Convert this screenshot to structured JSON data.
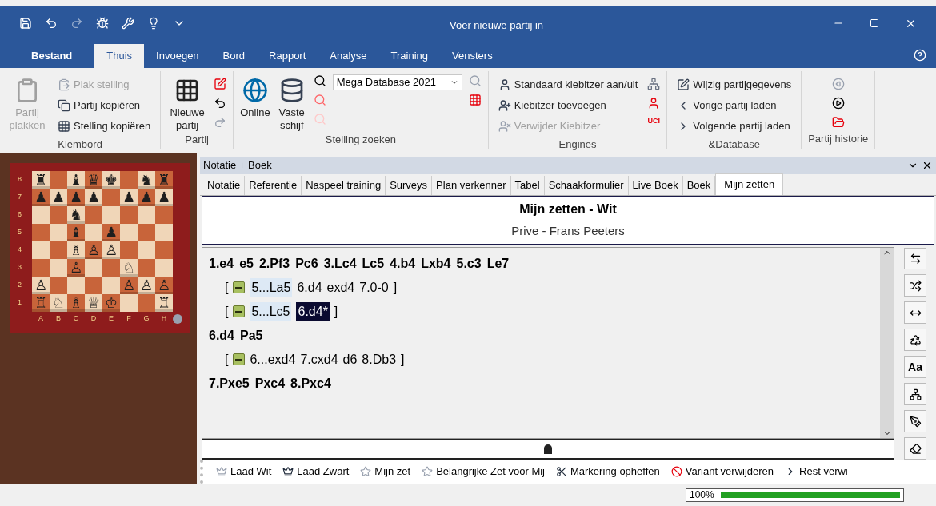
{
  "window": {
    "title": "Voer nieuwe partij in"
  },
  "ribbon_tabs": [
    {
      "label": "Bestand",
      "selected": false
    },
    {
      "label": "Thuis",
      "selected": true
    },
    {
      "label": "Invoegen",
      "selected": false
    },
    {
      "label": "Bord",
      "selected": false
    },
    {
      "label": "Rapport",
      "selected": false
    },
    {
      "label": "Analyse",
      "selected": false
    },
    {
      "label": "Training",
      "selected": false
    },
    {
      "label": "Vensters",
      "selected": false
    }
  ],
  "ribbon": {
    "klembord": {
      "label": "Klembord",
      "paste": {
        "label": "Partij plakken",
        "disabled": true
      },
      "items": [
        {
          "label": "Plak stelling",
          "disabled": true
        },
        {
          "label": "Partij kopiëren",
          "disabled": false
        },
        {
          "label": "Stelling kopiëren",
          "disabled": false
        }
      ]
    },
    "partij": {
      "label": "Partij",
      "new_game": "Nieuwe partij"
    },
    "stelling_zoeken": {
      "label": "Stelling zoeken",
      "online": "Online",
      "disk": "Vaste schijf",
      "database": "Mega Database 2021"
    },
    "engines": {
      "label": "Engines",
      "uci": "UCI",
      "items": [
        {
          "label": "Standaard kiebitzer aan/uit",
          "disabled": false
        },
        {
          "label": "Kiebitzer toevoegen",
          "disabled": false
        },
        {
          "label": "Verwijder Kiebitzer",
          "disabled": true
        }
      ]
    },
    "database": {
      "label": "&Database",
      "items": [
        {
          "label": "Wijzig partijgegevens",
          "disabled": false
        },
        {
          "label": "Vorige partij laden",
          "disabled": false
        },
        {
          "label": "Volgende partij laden",
          "disabled": false
        }
      ]
    },
    "historie": {
      "label": "Partij historie"
    }
  },
  "board": {
    "rank_labels": [
      "8",
      "7",
      "6",
      "5",
      "4",
      "3",
      "2",
      "1"
    ],
    "file_labels": [
      "A",
      "B",
      "C",
      "D",
      "E",
      "F",
      "G",
      "H"
    ],
    "position": [
      [
        {
          "empty": false,
          "piece": "♜"
        },
        {
          "empty": true
        },
        {
          "empty": false,
          "piece": "♝"
        },
        {
          "empty": false,
          "piece": "♛"
        },
        {
          "empty": false,
          "piece": "♚"
        },
        {
          "empty": true
        },
        {
          "empty": false,
          "piece": "♞"
        },
        {
          "empty": false,
          "piece": "♜"
        }
      ],
      [
        {
          "empty": false,
          "piece": "♟"
        },
        {
          "empty": false,
          "piece": "♟"
        },
        {
          "empty": false,
          "piece": "♟"
        },
        {
          "empty": false,
          "piece": "♟"
        },
        {
          "empty": true
        },
        {
          "empty": false,
          "piece": "♟"
        },
        {
          "empty": false,
          "piece": "♟"
        },
        {
          "empty": false,
          "piece": "♟"
        }
      ],
      [
        {
          "empty": true
        },
        {
          "empty": true
        },
        {
          "empty": false,
          "piece": "♞"
        },
        {
          "empty": true
        },
        {
          "empty": true
        },
        {
          "empty": true
        },
        {
          "empty": true
        },
        {
          "empty": true
        }
      ],
      [
        {
          "empty": true
        },
        {
          "empty": true
        },
        {
          "empty": false,
          "piece": "♝"
        },
        {
          "empty": true
        },
        {
          "empty": false,
          "piece": "♟"
        },
        {
          "empty": true
        },
        {
          "empty": true
        },
        {
          "empty": true
        }
      ],
      [
        {
          "empty": true
        },
        {
          "empty": true
        },
        {
          "empty": false,
          "piece": "♗"
        },
        {
          "empty": false,
          "piece": "♙"
        },
        {
          "empty": false,
          "piece": "♙"
        },
        {
          "empty": true
        },
        {
          "empty": true
        },
        {
          "empty": true
        }
      ],
      [
        {
          "empty": true
        },
        {
          "empty": true
        },
        {
          "empty": false,
          "piece": "♙"
        },
        {
          "empty": true
        },
        {
          "empty": true
        },
        {
          "empty": false,
          "piece": "♘"
        },
        {
          "empty": true
        },
        {
          "empty": true
        }
      ],
      [
        {
          "empty": false,
          "piece": "♙"
        },
        {
          "empty": true
        },
        {
          "empty": true
        },
        {
          "empty": true
        },
        {
          "empty": true
        },
        {
          "empty": false,
          "piece": "♙"
        },
        {
          "empty": false,
          "piece": "♙"
        },
        {
          "empty": false,
          "piece": "♙"
        }
      ],
      [
        {
          "empty": false,
          "piece": "♖"
        },
        {
          "empty": false,
          "piece": "♘"
        },
        {
          "empty": false,
          "piece": "♗"
        },
        {
          "empty": false,
          "piece": "♕"
        },
        {
          "empty": false,
          "piece": "♔"
        },
        {
          "empty": true
        },
        {
          "empty": true
        },
        {
          "empty": false,
          "piece": "♖"
        }
      ]
    ]
  },
  "panel": {
    "title": "Notatie + Boek",
    "tabs": [
      {
        "label": "Notatie",
        "selected": false
      },
      {
        "label": "Referentie",
        "selected": false
      },
      {
        "label": "Naspeel training",
        "selected": false
      },
      {
        "label": "Surveys",
        "selected": false
      },
      {
        "label": "Plan verkenner",
        "selected": false
      },
      {
        "label": "Tabel",
        "selected": false
      },
      {
        "label": "Schaakformulier",
        "selected": false
      },
      {
        "label": "Live Boek",
        "selected": false
      },
      {
        "label": "Boek",
        "selected": false
      },
      {
        "label": "Mijn zetten",
        "selected": true
      }
    ],
    "heading": "Mijn zetten - Wit",
    "subheading": "Prive - Frans Peeters",
    "font_tool": "Aa",
    "lines": [
      {
        "kind": "main",
        "moves": [
          {
            "text": "1.e4",
            "selected": false,
            "marked": false
          },
          {
            "text": "e5",
            "selected": false,
            "marked": false
          },
          {
            "text": "2.Pf3",
            "selected": false,
            "marked": false
          },
          {
            "text": "Pc6",
            "selected": false,
            "marked": false
          },
          {
            "text": "3.Lc4",
            "selected": false,
            "marked": false
          },
          {
            "text": "Lc5",
            "selected": false,
            "marked": false
          },
          {
            "text": "4.b4",
            "selected": false,
            "marked": false
          },
          {
            "text": "Lxb4",
            "selected": false,
            "marked": false
          },
          {
            "text": "5.c3",
            "selected": false,
            "marked": false
          },
          {
            "text": "Le7",
            "selected": false,
            "marked": false
          }
        ]
      },
      {
        "kind": "variation",
        "expanded": true,
        "open": "[",
        "close": "]",
        "moves": [
          {
            "text": "5...La5",
            "selected": false,
            "marked": true
          },
          {
            "text": "6.d4",
            "selected": false,
            "marked": false
          },
          {
            "text": "exd4",
            "selected": false,
            "marked": false
          },
          {
            "text": "7.0-0",
            "selected": false,
            "marked": false
          }
        ]
      },
      {
        "kind": "variation",
        "expanded": true,
        "open": "[",
        "close": "]",
        "moves": [
          {
            "text": "5...Lc5",
            "selected": false,
            "marked": true
          },
          {
            "text": "6.d4*",
            "selected": true,
            "marked": false
          }
        ]
      },
      {
        "kind": "main",
        "moves": [
          {
            "text": "6.d4",
            "selected": false,
            "marked": false
          },
          {
            "text": "Pa5",
            "selected": false,
            "marked": false
          }
        ]
      },
      {
        "kind": "variation",
        "expanded": true,
        "open": "[",
        "close": "]",
        "moves": [
          {
            "text": "6...exd4",
            "selected": false,
            "marked": false
          },
          {
            "text": "7.cxd4",
            "selected": false,
            "marked": false
          },
          {
            "text": "d6",
            "selected": false,
            "marked": false
          },
          {
            "text": "8.Db3",
            "selected": false,
            "marked": false
          }
        ]
      },
      {
        "kind": "main",
        "moves": [
          {
            "text": "7.Pxe5",
            "selected": false,
            "marked": false
          },
          {
            "text": "Pxc4",
            "selected": false,
            "marked": false
          },
          {
            "text": "8.Pxc4",
            "selected": false,
            "marked": false
          }
        ]
      }
    ]
  },
  "bottom_toolbar": [
    {
      "label": "Laad Wit"
    },
    {
      "label": "Laad Zwart"
    },
    {
      "label": "Mijn zet"
    },
    {
      "label": "Belangrijke Zet voor Mij"
    },
    {
      "label": "Markering opheffen"
    },
    {
      "label": "Variant verwijderen"
    },
    {
      "label": "Rest verwi"
    }
  ],
  "status": {
    "zoom": "100%",
    "level": 1
  }
}
